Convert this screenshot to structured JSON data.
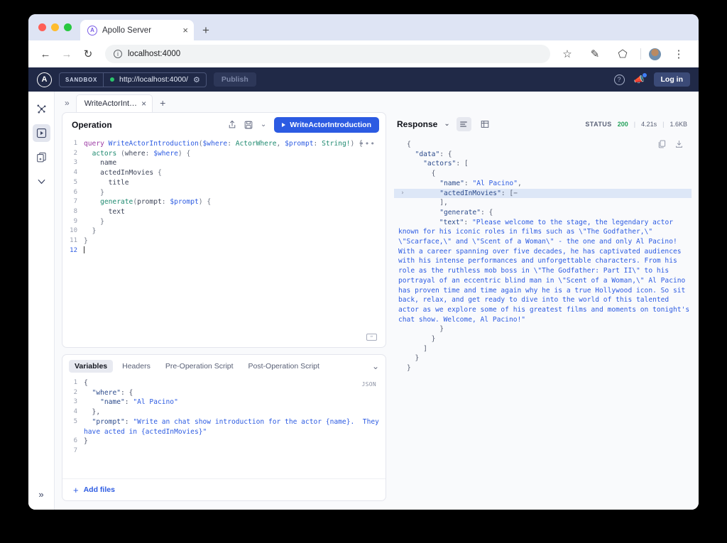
{
  "browser": {
    "tab": {
      "title": "Apollo Server",
      "favicon": "apollo-logo-icon",
      "close": "×"
    },
    "new_tab": "+",
    "back": "←",
    "forward": "→",
    "reload": "↻",
    "url": "localhost:4000",
    "star": "☆",
    "pencil": "✎",
    "extensions": "⬠",
    "menu": "⋮"
  },
  "apollo_nav": {
    "logo": "A",
    "sandbox_tag": "SANDBOX",
    "endpoint": "http://localhost:4000/",
    "gear": "⚙",
    "publish": "Publish",
    "help": "?",
    "login": "Log in"
  },
  "rail": {
    "items": [
      {
        "name": "schema-icon"
      },
      {
        "name": "explorer-icon",
        "active": true
      },
      {
        "name": "collections-icon"
      },
      {
        "name": "checks-icon"
      }
    ],
    "expand": "»"
  },
  "op_tabs": {
    "expand": "»",
    "tab_label": "WriteActorInt…",
    "tab_close": "×",
    "add": "+"
  },
  "operation": {
    "title": "Operation",
    "share_icon": "share-icon",
    "save_icon": "save-icon",
    "chevron": "⌄",
    "run_label": "WriteActorIntroduction",
    "more": "•••",
    "lines": [
      {
        "n": "1",
        "text": "query WriteActorIntroduction($where: ActorWhere, $prompt: String!) {"
      },
      {
        "n": "2",
        "text": "  actors (where: $where) {"
      },
      {
        "n": "3",
        "text": "    name"
      },
      {
        "n": "4",
        "text": "    actedInMovies {"
      },
      {
        "n": "5",
        "text": "      title"
      },
      {
        "n": "6",
        "text": "    }"
      },
      {
        "n": "7",
        "text": "    generate(prompt: $prompt) {"
      },
      {
        "n": "8",
        "text": "      text"
      },
      {
        "n": "9",
        "text": "    }"
      },
      {
        "n": "10",
        "text": "  }"
      },
      {
        "n": "11",
        "text": "}"
      },
      {
        "n": "12",
        "text": ""
      }
    ]
  },
  "variables": {
    "tabs": [
      {
        "label": "Variables",
        "active": true
      },
      {
        "label": "Headers",
        "active": false
      },
      {
        "label": "Pre-Operation Script",
        "active": false
      },
      {
        "label": "Post-Operation Script",
        "active": false
      }
    ],
    "collapse": "⌄",
    "format_tag": "JSON",
    "lines": [
      {
        "n": "1",
        "text": "{"
      },
      {
        "n": "2",
        "text": "  \"where\": {"
      },
      {
        "n": "3",
        "text": "    \"name\": \"Al Pacino\""
      },
      {
        "n": "4",
        "text": "  },"
      },
      {
        "n": "5",
        "text": "  \"prompt\": \"Write an chat show introduction for the actor {name}.  They"
      },
      {
        "n": "",
        "text": "have acted in {actedInMovies}\""
      },
      {
        "n": "6",
        "text": "}"
      },
      {
        "n": "7",
        "text": ""
      }
    ],
    "add_files": "Add files",
    "plus": "+"
  },
  "response": {
    "title": "Response",
    "chevron": "⌄",
    "view_json": "json-view-icon",
    "view_table": "table-view-icon",
    "status_label": "STATUS",
    "status_code": "200",
    "duration": "4.21s",
    "size": "1.6KB",
    "copy_icon": "copy-icon",
    "download_icon": "download-icon",
    "lines": [
      {
        "text": "{"
      },
      {
        "text": "  \"data\": {"
      },
      {
        "text": "    \"actors\": ["
      },
      {
        "text": "      {"
      },
      {
        "text": "        \"name\": \"Al Pacino\","
      },
      {
        "text": "        \"actedInMovies\": [−",
        "highlight": true,
        "gutter": "›"
      },
      {
        "text": "        ],"
      },
      {
        "text": "        \"generate\": {"
      }
    ],
    "text_prefix": "          \"text\": ",
    "text_value": "\"Please welcome to the stage, the legendary actor known for his iconic roles in films such as \\\"The Godfather,\\\" \\\"Scarface,\\\" and \\\"Scent of a Woman\\\" - the one and only Al Pacino! With a career spanning over five decades, he has captivated audiences with his intense performances and unforgettable characters. From his role as the ruthless mob boss in \\\"The Godfather: Part II\\\" to his portrayal of an eccentric blind man in \\\"Scent of a Woman,\\\" Al Pacino has proven time and time again why he is a true Hollywood icon. So sit back, relax, and get ready to dive into the world of this talented actor as we explore some of his greatest films and moments on tonight's chat show. Welcome, Al Pacino!\"",
    "closing_lines": [
      {
        "text": "        }"
      },
      {
        "text": "      }"
      },
      {
        "text": "    ]"
      },
      {
        "text": "  }"
      },
      {
        "text": "}"
      }
    ]
  },
  "colors": {
    "accent": "#2c5be2",
    "nav_bg": "#202947",
    "status_ok": "#24a25b",
    "highlight_row": "#dde7f7"
  }
}
